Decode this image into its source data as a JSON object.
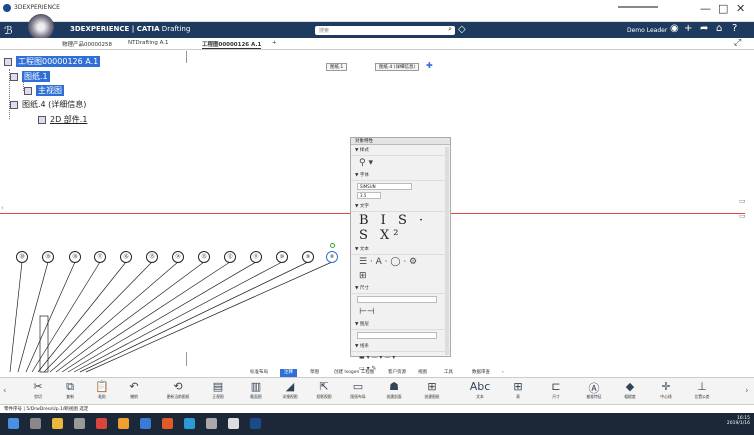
{
  "window": {
    "title": "3DEXPERIENCE",
    "min": "—",
    "max": "□",
    "close": "✕"
  },
  "topbar": {
    "brand_bold": "3DEXPERIENCE | CATIA",
    "brand_app": " Drafting",
    "search_placeholder": "搜索",
    "user": "Demo Leader"
  },
  "tabs": [
    {
      "label": "物理产品00000258"
    },
    {
      "label": "NTDrafting A.1"
    },
    {
      "label": "工程图00000126 A.1"
    },
    {
      "label": "+"
    }
  ],
  "tree": [
    {
      "label": "工程图00000126 A.1"
    },
    {
      "label": "图纸.1"
    },
    {
      "label": "主视图"
    },
    {
      "label": "图纸.4 (详细信息)"
    },
    {
      "label": "2D 部件.1"
    }
  ],
  "sheet_buttons": [
    "图纸.1",
    "图纸.4 (详细信息)"
  ],
  "balloons": [
    "⑳",
    "⑲",
    "⑱",
    "⑰",
    "⑯",
    "⑮",
    "⑭",
    "⑬",
    "⑫",
    "⑪",
    "⑩",
    "⑨",
    "⑧"
  ],
  "properties": {
    "header": "对象特性",
    "sections": [
      "样式",
      "字体",
      "文字",
      "文本",
      "尺寸",
      "图层",
      "线条"
    ],
    "font_name": "SIMSUN",
    "font_size": "3.5",
    "format_glyphs": "B I S · S X²"
  },
  "command_tabs": [
    "标准布局",
    "注释",
    "草图",
    "创建 Isogen 工程图",
    "客户资源",
    "视图",
    "工具",
    "数据审查",
    "›"
  ],
  "tools": [
    {
      "icon": "✂",
      "label": "剪切"
    },
    {
      "icon": "⧉",
      "label": "复制"
    },
    {
      "icon": "📋",
      "label": "粘贴"
    },
    {
      "icon": "↶",
      "label": "撤销"
    },
    {
      "icon": "⟲",
      "label": "更新当前图纸"
    },
    {
      "icon": "▤",
      "label": "正视图"
    },
    {
      "icon": "▥",
      "label": "截面图"
    },
    {
      "icon": "◢",
      "label": "详细视图"
    },
    {
      "icon": "⇱",
      "label": "投影视图"
    },
    {
      "icon": "▭",
      "label": "图纸布局"
    },
    {
      "icon": "☗",
      "label": "创建剖面"
    },
    {
      "icon": "⊞",
      "label": "创建图纸"
    },
    {
      "icon": "Abc",
      "label": "文本"
    },
    {
      "icon": "⊞",
      "label": "表"
    },
    {
      "icon": "⊏",
      "label": "尺寸"
    },
    {
      "icon": "Ⓐ",
      "label": "基准特征"
    },
    {
      "icon": "◆",
      "label": "粗糙度"
    },
    {
      "icon": "✛",
      "label": "中心线"
    },
    {
      "icon": "⊥",
      "label": "位置公差"
    }
  ],
  "status": "零件序号 | 5/DrwDressUp.1/断视图 选定",
  "taskbar": {
    "time": "16:15",
    "date": "2019/1/16"
  },
  "colors": {
    "topbar": "#1e3a5f",
    "selection": "#2f6fd6",
    "redline": "#e04848"
  }
}
